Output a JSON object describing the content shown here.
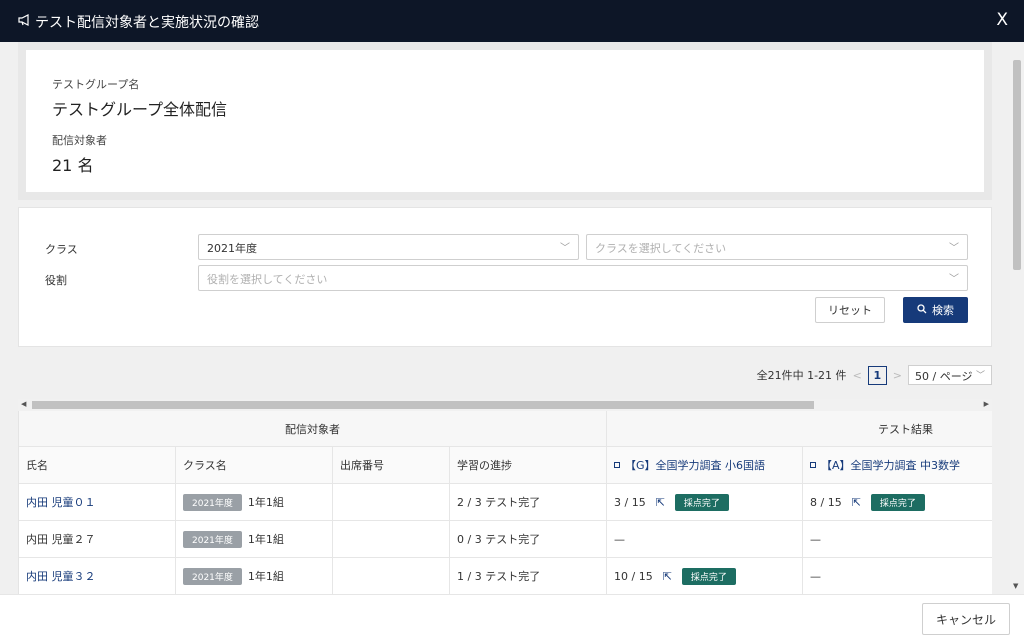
{
  "header": {
    "icon": "megaphone-icon",
    "title": "テスト配信対象者と実施状況の確認",
    "close": "X"
  },
  "info": {
    "group_label": "テストグループ名",
    "group_value": "テストグループ全体配信",
    "target_label": "配信対象者",
    "target_value": "21 名"
  },
  "filters": {
    "class_label": "クラス",
    "class_year": "2021年度",
    "class_placeholder": "クラスを選択してください",
    "role_label": "役割",
    "role_placeholder": "役割を選択してください",
    "reset": "リセット",
    "search": "検索"
  },
  "pager": {
    "summary": "全21件中 1-21 件",
    "page": "1",
    "page_size": "50 / ページ"
  },
  "table": {
    "group_headers": {
      "targets": "配信対象者",
      "results": "テスト結果"
    },
    "columns": {
      "name": "氏名",
      "class": "クラス名",
      "seat": "出席番号",
      "progress": "学習の進捗",
      "test1": "【G】全国学力調査 小6国語",
      "test2": "【A】全国学力調査 中3数学"
    },
    "rows": [
      {
        "name": "内田 児童０１",
        "year": "2021年度",
        "class": "1年1組",
        "seat": "",
        "progress": "2 / 3 テスト完了",
        "t1_score": "3 / 15",
        "t1_status": "採点完了",
        "t2_score": "8 / 15",
        "t2_status": "採点完了"
      },
      {
        "name": "内田 児童２７",
        "year": "2021年度",
        "class": "1年1組",
        "seat": "",
        "progress": "0 / 3 テスト完了",
        "t1_score": "—",
        "t2_score": "—"
      },
      {
        "name": "内田 児童３２",
        "year": "2021年度",
        "class": "1年1組",
        "seat": "",
        "progress": "1 / 3 テスト完了",
        "t1_score": "10 / 15",
        "t1_status": "採点完了",
        "t2_score": "—"
      }
    ]
  },
  "footer": {
    "cancel": "キャンセル"
  },
  "colors": {
    "header_bg": "#0d1627",
    "primary": "#163a7a",
    "done_badge": "#1d6d62",
    "year_badge": "#9aa0a6"
  }
}
